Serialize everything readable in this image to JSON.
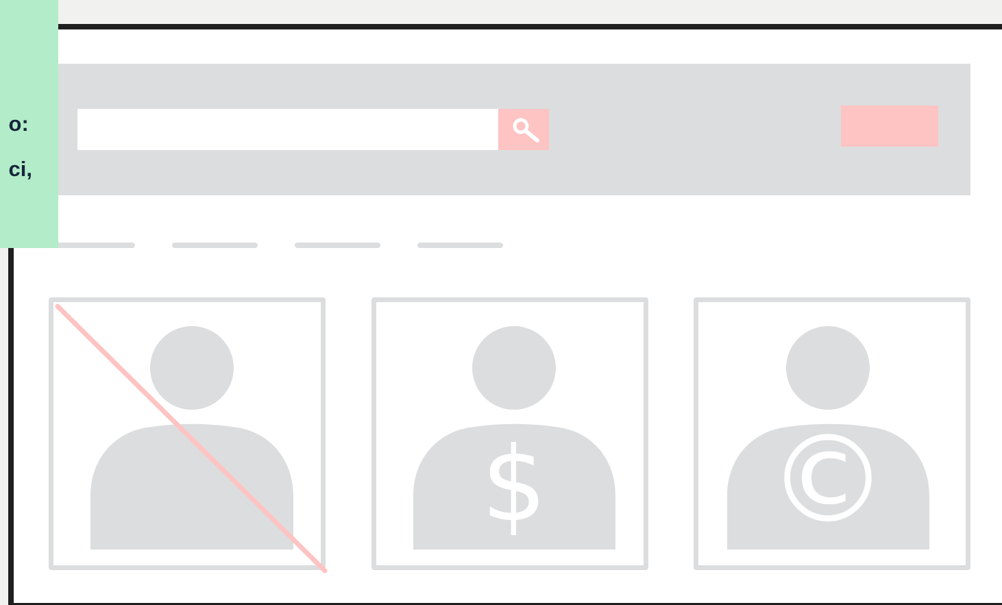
{
  "note_panel": {
    "text": "o:\nci,"
  },
  "search": {
    "value": "",
    "placeholder": "",
    "icon": "search-icon"
  },
  "header_action": {
    "label": ""
  },
  "nav_tabs": [
    {
      "label": ""
    },
    {
      "label": ""
    },
    {
      "label": ""
    },
    {
      "label": ""
    }
  ],
  "cards": [
    {
      "icon": "person-crossed-out-icon",
      "symbol": ""
    },
    {
      "icon": "person-dollar-icon",
      "symbol": "$"
    },
    {
      "icon": "person-copyright-icon",
      "symbol": "©"
    }
  ],
  "colors": {
    "background": "#f1f1ef",
    "frame": "#1f1f1f",
    "placeholder_gray": "#dcddde",
    "accent_pink": "#fec3c3",
    "note_green": "#b3ecc8",
    "note_text": "#15263a",
    "white": "#ffffff"
  }
}
